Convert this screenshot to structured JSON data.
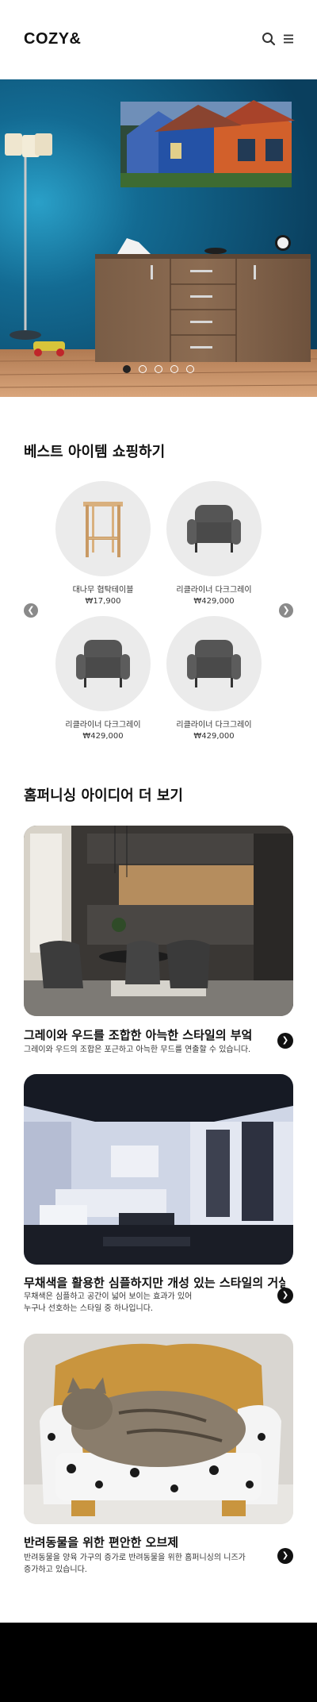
{
  "header": {
    "logo": "COZY&",
    "search_icon": "search-icon",
    "menu_icon": "hamburger-menu-icon"
  },
  "hero": {
    "slide_count": 5,
    "active_slide": 1
  },
  "best_items": {
    "title": "베스트 아이템 쇼핑하기",
    "prev_icon": "chevron-left-icon",
    "next_icon": "chevron-right-icon",
    "products": [
      {
        "name": "대나무 협탁테이블",
        "price": "₩17,900"
      },
      {
        "name": "리클라이너 다크그레이",
        "price": "₩429,000"
      },
      {
        "name": "리클라이너 다크그레이",
        "price": "₩429,000"
      },
      {
        "name": "리클라이너 다크그레이",
        "price": "₩429,000"
      }
    ]
  },
  "ideas": {
    "title": "홈퍼니싱 아이디어 더 보기",
    "cards": [
      {
        "heading": "그레이와 우드를 조합한 아늑한 스타일의 부엌",
        "desc_line1": "그레이와 우드의 조합은 포근하고 아늑한 무드를 연출할 수 있습니다.",
        "desc_line2": ""
      },
      {
        "heading": "무채색을 활용한 심플하지만 개성 있는 스타일의 거실",
        "desc_line1": "무채색은 심플하고 공간이 넓어 보이는 효과가 있어",
        "desc_line2": "누구나 선호하는 스타일 중 하나입니다."
      },
      {
        "heading": "반려동물을 위한 편안한 오브제",
        "desc_line1": "반려동물을 양육 가구의 증가로 반려동물을 위한 홈퍼니싱의 니즈가",
        "desc_line2": "증가하고 있습니다."
      }
    ]
  },
  "colors": {
    "accent": "#111111",
    "hero_wall": "#0e5a80",
    "product_bg": "#ebebeb",
    "footer": "#000000"
  }
}
